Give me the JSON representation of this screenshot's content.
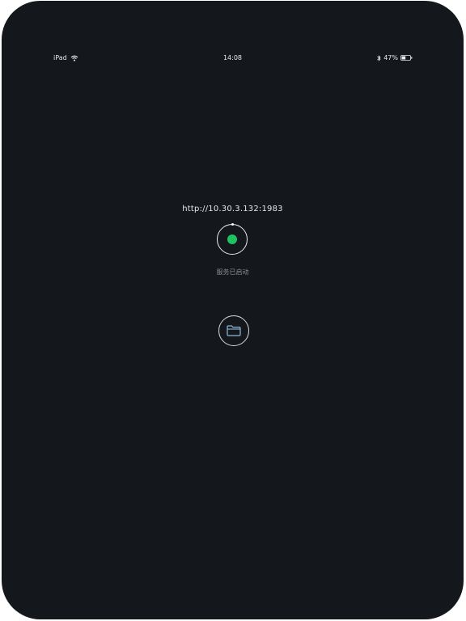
{
  "status_bar": {
    "device": "iPad",
    "time": "14:08",
    "battery_percent": "47%",
    "battery_level": 0.47,
    "icons": {
      "wifi": "wifi-icon",
      "bluetooth": "bluetooth-icon",
      "battery": "battery-icon"
    }
  },
  "server": {
    "url": "http://10.30.3.132:1983",
    "status_text": "服务已启动",
    "status_color": "#1ec263"
  },
  "actions": {
    "toggle_icon": "power-status-icon",
    "folder_icon": "folder-icon",
    "folder_color": "#8fb7d8"
  },
  "colors": {
    "background": "#14181c",
    "text": "#e3e7ea",
    "muted_text": "#8a8f94"
  }
}
